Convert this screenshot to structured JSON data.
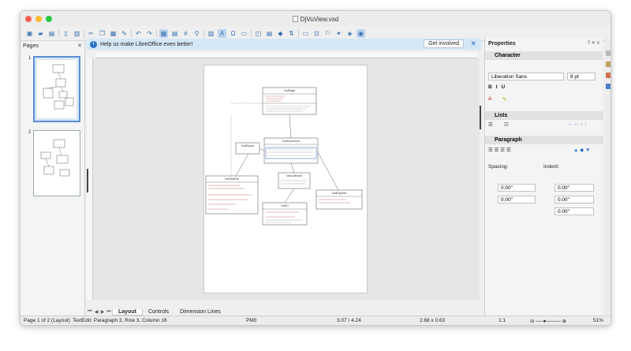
{
  "window": {
    "title": "DjVuView.vsd"
  },
  "pages_panel": {
    "title": "Pages",
    "thumbnails": [
      "1",
      "2"
    ]
  },
  "infobar": {
    "message": "Help us make LibreOffice even better!",
    "button_label": "Get involved"
  },
  "sheet_tabs": {
    "tabs": [
      "Layout",
      "Controls",
      "Dimension Lines"
    ],
    "active": "Layout"
  },
  "status": {
    "page": "Page 1 of 2 (Layout)",
    "edit": "TextEdit: Paragraph 3, Row 3, Column 16",
    "layer": "PM0",
    "position": "3.07 / 4.24",
    "size": "2.68 x 0.63",
    "scale": "1:1",
    "zoom": "51%"
  },
  "properties": {
    "title": "Properties",
    "character": {
      "label": "Character",
      "font": "Liberation Sans",
      "size": "8 pt"
    },
    "lists": {
      "label": "Lists"
    },
    "paragraph": {
      "label": "Paragraph",
      "spacing_label": "Spacing:",
      "indent_label": "Indent:",
      "above": "0.00\"",
      "below": "0.00\"",
      "before": "0.00\"",
      "after": "0.00\"",
      "first_line": "0.00\""
    }
  },
  "diagram": {
    "classes": [
      "VsdPage",
      "VsdDocument",
      "VsdExport",
      "VsdCollector",
      "VsdTextFile",
      "VsdExporter",
      "VsdIO",
      "VsdParser"
    ]
  }
}
